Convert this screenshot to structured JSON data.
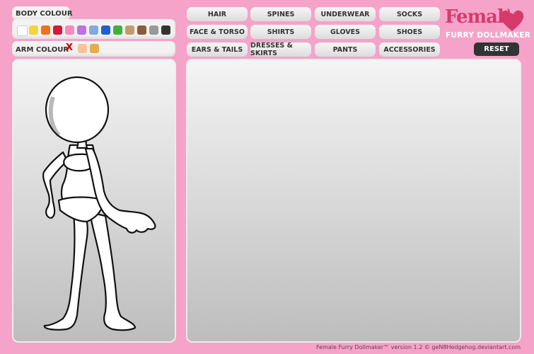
{
  "body_colour": {
    "label": "BODY COLOUR",
    "swatches": [
      "#ffffff",
      "#f5d53a",
      "#f07020",
      "#d41a3a",
      "#f48ac0",
      "#c070e0",
      "#80aadd",
      "#2060c8",
      "#40b040",
      "#c49a6c",
      "#8b5a3a",
      "#999999",
      "#333333"
    ]
  },
  "arm_colour": {
    "label": "ARM COLOUR",
    "none_symbol": "X",
    "swatches": [
      "#f9c396",
      "#e8ac4c"
    ]
  },
  "categories": [
    "HAIR",
    "SPINES",
    "UNDERWEAR",
    "SOCKS",
    "FACE & TORSO",
    "SHIRTS",
    "GLOVES",
    "SHOES",
    "EARS & TAILS",
    "DRESSES & SKIRTS",
    "PANTS",
    "ACCESSORIES"
  ],
  "reset_label": "RESET",
  "logo": {
    "title": "Female",
    "subtitle": "FURRY DOLLMAKER"
  },
  "footer": "Female Furry Dollmaker™ version 1.2 © geN8Hedgehog.deviantart.com"
}
